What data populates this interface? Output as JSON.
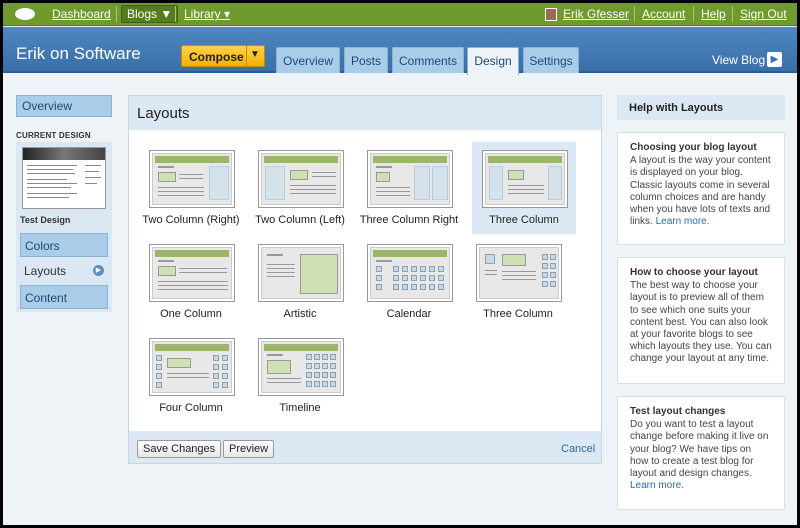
{
  "topbar": {
    "dashboard": "Dashboard",
    "blogs": "Blogs ▼",
    "library": "Library ▾",
    "user": "Erik Gfesser",
    "account": "Account",
    "help": "Help",
    "signout": "Sign Out"
  },
  "header": {
    "blog_title": "Erik on Software",
    "compose": "Compose",
    "tabs": [
      "Overview",
      "Posts",
      "Comments",
      "Design",
      "Settings"
    ],
    "active_tab": "Design",
    "view_blog": "View Blog"
  },
  "leftnav": {
    "overview": "Overview",
    "current_design_label": "CURRENT DESIGN",
    "design_name": "Test Design",
    "items": [
      "Colors",
      "Layouts",
      "Content"
    ],
    "current_item": "Layouts"
  },
  "main": {
    "title": "Layouts",
    "layouts": [
      "Two Column (Right)",
      "Two Column (Left)",
      "Three Column Right",
      "Three Column",
      "One Column",
      "Artistic",
      "Calendar",
      "Three Column",
      "Four Column",
      "Timeline"
    ],
    "selected": "Three Column",
    "save": "Save Changes",
    "preview": "Preview",
    "cancel": "Cancel"
  },
  "help": {
    "title": "Help with Layouts",
    "cards": [
      {
        "heading": "Choosing your blog layout",
        "body": "A layout is the way your content is displayed on your blog. Classic layouts come in several column choices and are handy when you have lots of texts and links.",
        "link": "Learn more."
      },
      {
        "heading": "How to choose your layout",
        "body": "The best way to choose your layout is to preview all of them to see which one suits your content best. You can also look at your favorite blogs to see which layouts they use. You can change your layout at any time.",
        "link": ""
      },
      {
        "heading": "Test layout changes",
        "body": "Do you want to test a layout change before making it live on your blog? We have tips on how to create a test blog for layout and design changes.",
        "link": "Learn more."
      }
    ]
  },
  "colors": {
    "topbar": "#6f9a2d",
    "header": "#3a6fa8",
    "tab": "#a9cce8",
    "compose": "#f1b100"
  }
}
